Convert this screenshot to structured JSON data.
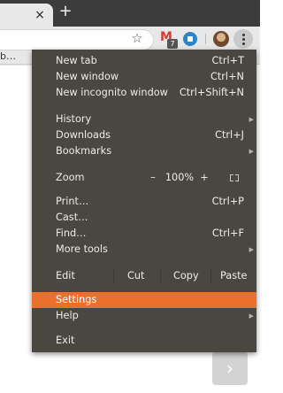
{
  "tabstrip": {
    "close_glyph": "×",
    "new_tab_glyph": "+"
  },
  "bookmarks": {
    "fragment": "b…"
  },
  "extensions": {
    "gmail_badge": "7"
  },
  "menu": {
    "new_tab": {
      "label": "New tab",
      "shortcut": "Ctrl+T"
    },
    "new_window": {
      "label": "New window",
      "shortcut": "Ctrl+N"
    },
    "new_incognito": {
      "label": "New incognito window",
      "shortcut": "Ctrl+Shift+N"
    },
    "history": {
      "label": "History"
    },
    "downloads": {
      "label": "Downloads",
      "shortcut": "Ctrl+J"
    },
    "bookmarks": {
      "label": "Bookmarks"
    },
    "zoom": {
      "label": "Zoom",
      "minus": "–",
      "value": "100%",
      "plus": "+"
    },
    "print": {
      "label": "Print…",
      "shortcut": "Ctrl+P"
    },
    "cast": {
      "label": "Cast…"
    },
    "find": {
      "label": "Find…",
      "shortcut": "Ctrl+F"
    },
    "more_tools": {
      "label": "More tools"
    },
    "edit": {
      "label": "Edit",
      "cut": "Cut",
      "copy": "Copy",
      "paste": "Paste"
    },
    "settings": {
      "label": "Settings"
    },
    "help": {
      "label": "Help"
    },
    "exit": {
      "label": "Exit"
    }
  },
  "page": {
    "next_glyph": "›"
  },
  "colors": {
    "menu_bg": "#4a4741",
    "highlight": "#e9702d",
    "menu_text": "#ececec"
  },
  "icons": [
    "star-icon",
    "gmail-icon",
    "secure-extension-icon",
    "profile-avatar",
    "menu-icon",
    "submenu-arrow-icon",
    "fullscreen-icon",
    "chevron-right-icon"
  ]
}
